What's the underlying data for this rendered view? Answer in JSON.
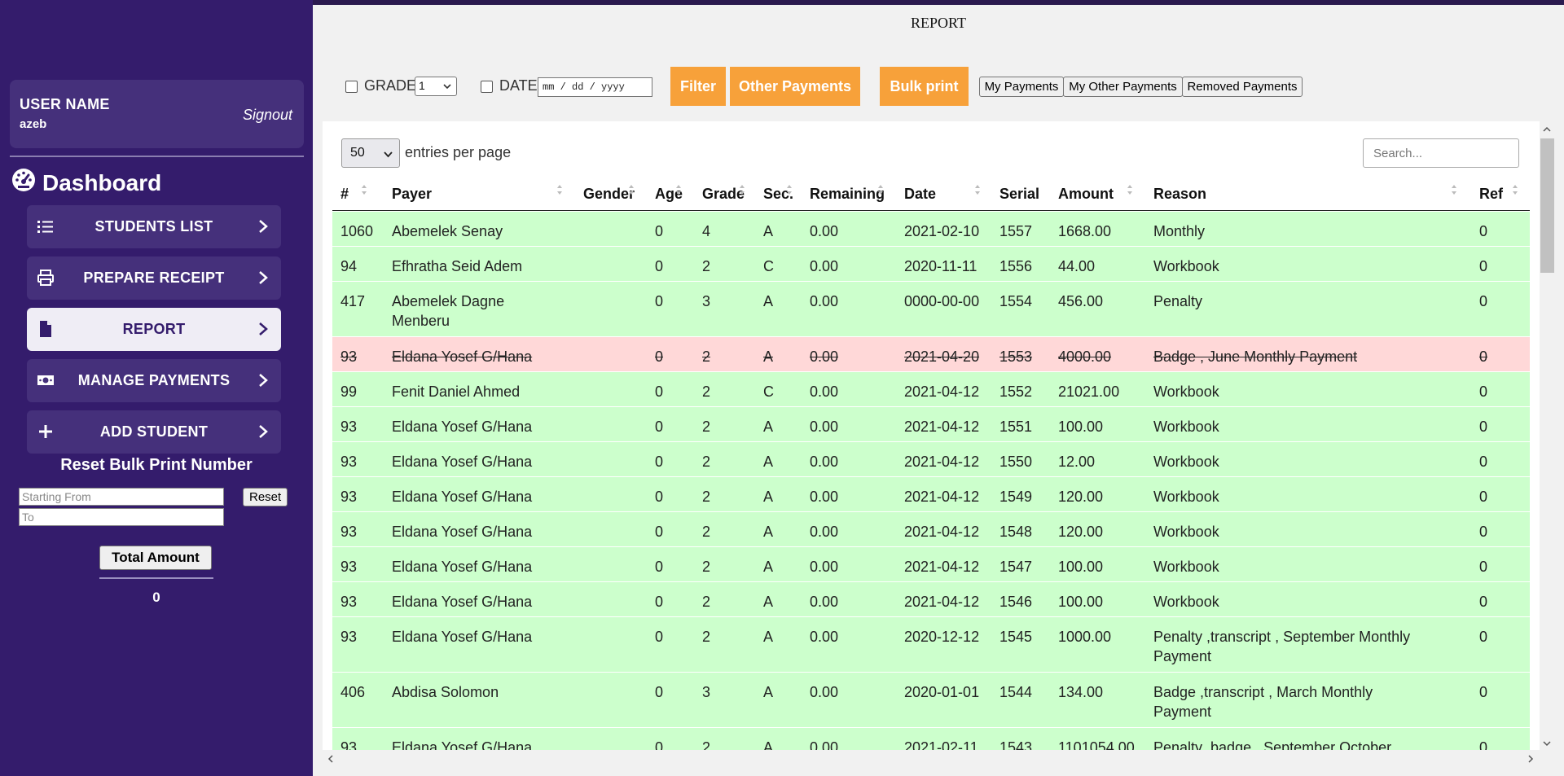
{
  "sidebar": {
    "user_label": "USER NAME",
    "user_name": "azeb",
    "signout": "Signout",
    "dashboard": "Dashboard",
    "nav": [
      {
        "label": "STUDENTS LIST",
        "icon": "list-icon"
      },
      {
        "label": "PREPARE RECEIPT",
        "icon": "printer-icon"
      },
      {
        "label": "REPORT",
        "icon": "document-icon",
        "active": true
      },
      {
        "label": "MANAGE PAYMENTS",
        "icon": "money-icon"
      },
      {
        "label": "ADD STUDENT",
        "icon": "plus-icon"
      }
    ],
    "reset_title": "Reset Bulk Print Number",
    "starting_placeholder": "Starting From",
    "to_placeholder": "To",
    "reset_button": "Reset",
    "total_button": "Total Amount",
    "total_value": "0"
  },
  "page": {
    "title": "REPORT"
  },
  "filters": {
    "grade_label": "GRADE",
    "grade_value": "1",
    "date_label": "DATE",
    "date_placeholder": "mm / dd / yyyy",
    "filter_button": "Filter",
    "other_payments_button": "Other Payments",
    "bulk_print_button": "Bulk print",
    "my_payments_button": "My Payments",
    "my_other_payments_button": "My Other Payments",
    "removed_payments_button": "Removed Payments"
  },
  "table": {
    "entries_value": "50",
    "entries_text": "entries per page",
    "search_placeholder": "Search...",
    "headers": [
      "#",
      "Payer",
      "Gender",
      "Age",
      "Grade",
      "Sec.",
      "Remaining",
      "Date",
      "Serial",
      "Amount",
      "Reason",
      "Ref"
    ],
    "rows": [
      {
        "id": "1060",
        "payer": "Abemelek Senay",
        "gender": "",
        "age": "0",
        "grade": "4",
        "sec": "A",
        "remaining": "0.00",
        "date": "2021-02-10",
        "serial": "1557",
        "amount": "1668.00",
        "reason": "Monthly",
        "ref": "0",
        "removed": false
      },
      {
        "id": "94",
        "payer": "Efhratha Seid Adem",
        "gender": "",
        "age": "0",
        "grade": "2",
        "sec": "C",
        "remaining": "0.00",
        "date": "2020-11-11",
        "serial": "1556",
        "amount": "44.00",
        "reason": "Workbook",
        "ref": "0",
        "removed": false
      },
      {
        "id": "417",
        "payer": "Abemelek Dagne Menberu",
        "gender": "",
        "age": "0",
        "grade": "3",
        "sec": "A",
        "remaining": "0.00",
        "date": "0000-00-00",
        "serial": "1554",
        "amount": "456.00",
        "reason": "Penalty",
        "ref": "0",
        "removed": false
      },
      {
        "id": "93",
        "payer": "Eldana Yosef G/Hana",
        "gender": "",
        "age": "0",
        "grade": "2",
        "sec": "A",
        "remaining": "0.00",
        "date": "2021-04-20",
        "serial": "1553",
        "amount": "4000.00",
        "reason": "Badge , June Monthly Payment",
        "ref": "0",
        "removed": true
      },
      {
        "id": "99",
        "payer": "Fenit Daniel Ahmed",
        "gender": "",
        "age": "0",
        "grade": "2",
        "sec": "C",
        "remaining": "0.00",
        "date": "2021-04-12",
        "serial": "1552",
        "amount": "21021.00",
        "reason": "Workbook",
        "ref": "0",
        "removed": false
      },
      {
        "id": "93",
        "payer": "Eldana Yosef G/Hana",
        "gender": "",
        "age": "0",
        "grade": "2",
        "sec": "A",
        "remaining": "0.00",
        "date": "2021-04-12",
        "serial": "1551",
        "amount": "100.00",
        "reason": "Workbook",
        "ref": "0",
        "removed": false
      },
      {
        "id": "93",
        "payer": "Eldana Yosef G/Hana",
        "gender": "",
        "age": "0",
        "grade": "2",
        "sec": "A",
        "remaining": "0.00",
        "date": "2021-04-12",
        "serial": "1550",
        "amount": "12.00",
        "reason": "Workbook",
        "ref": "0",
        "removed": false
      },
      {
        "id": "93",
        "payer": "Eldana Yosef G/Hana",
        "gender": "",
        "age": "0",
        "grade": "2",
        "sec": "A",
        "remaining": "0.00",
        "date": "2021-04-12",
        "serial": "1549",
        "amount": "120.00",
        "reason": "Workbook",
        "ref": "0",
        "removed": false
      },
      {
        "id": "93",
        "payer": "Eldana Yosef G/Hana",
        "gender": "",
        "age": "0",
        "grade": "2",
        "sec": "A",
        "remaining": "0.00",
        "date": "2021-04-12",
        "serial": "1548",
        "amount": "120.00",
        "reason": "Workbook",
        "ref": "0",
        "removed": false
      },
      {
        "id": "93",
        "payer": "Eldana Yosef G/Hana",
        "gender": "",
        "age": "0",
        "grade": "2",
        "sec": "A",
        "remaining": "0.00",
        "date": "2021-04-12",
        "serial": "1547",
        "amount": "100.00",
        "reason": "Workbook",
        "ref": "0",
        "removed": false
      },
      {
        "id": "93",
        "payer": "Eldana Yosef G/Hana",
        "gender": "",
        "age": "0",
        "grade": "2",
        "sec": "A",
        "remaining": "0.00",
        "date": "2021-04-12",
        "serial": "1546",
        "amount": "100.00",
        "reason": "Workbook",
        "ref": "0",
        "removed": false
      },
      {
        "id": "93",
        "payer": "Eldana Yosef G/Hana",
        "gender": "",
        "age": "0",
        "grade": "2",
        "sec": "A",
        "remaining": "0.00",
        "date": "2020-12-12",
        "serial": "1545",
        "amount": "1000.00",
        "reason": "Penalty ,transcript , September Monthly Payment",
        "ref": "0",
        "removed": false
      },
      {
        "id": "406",
        "payer": "Abdisa Solomon",
        "gender": "",
        "age": "0",
        "grade": "3",
        "sec": "A",
        "remaining": "0.00",
        "date": "2020-01-01",
        "serial": "1544",
        "amount": "134.00",
        "reason": "Badge ,transcript , March Monthly Payment",
        "ref": "0",
        "removed": false
      },
      {
        "id": "93",
        "payer": "Eldana Yosef G/Hana",
        "gender": "",
        "age": "0",
        "grade": "2",
        "sec": "A",
        "remaining": "0.00",
        "date": "2021-02-11",
        "serial": "1543",
        "amount": "1101054.00",
        "reason": "Penalty ,badge , September October Tutorial Payment",
        "ref": "0",
        "removed": false
      }
    ]
  },
  "colors": {
    "sidebar": "#341c6c",
    "card": "#45307b",
    "accent_orange": "#f7a13a",
    "row_green": "#ccffcc",
    "row_removed": "#ffd8d8"
  }
}
